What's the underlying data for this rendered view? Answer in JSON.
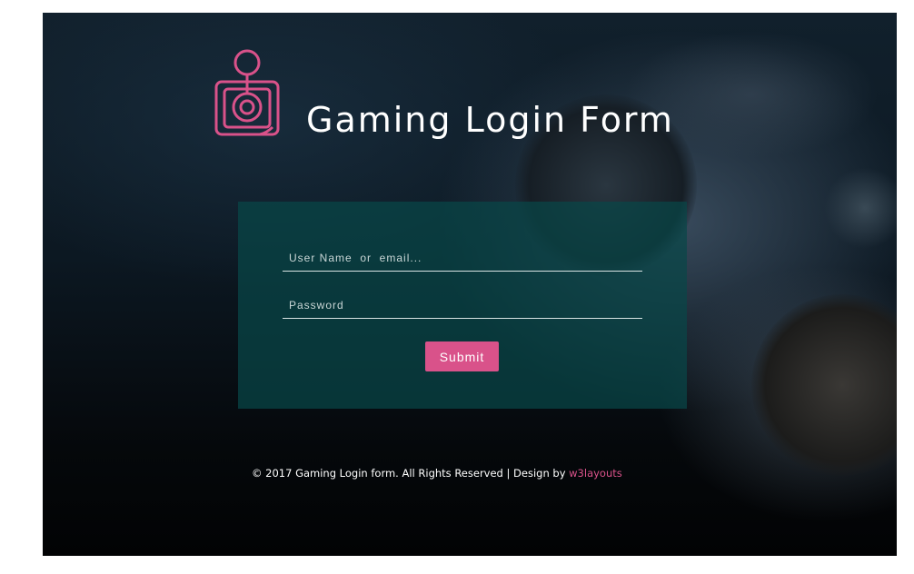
{
  "header": {
    "title": "Gaming Login Form",
    "logo_icon": "joystick-icon"
  },
  "form": {
    "username_placeholder": "User Name  or  email...",
    "password_placeholder": "Password",
    "submit_label": "Submit"
  },
  "footer": {
    "copyright_text": "© 2017 Gaming Login form. All Rights Reserved | Design by ",
    "designer_link": "w3layouts"
  },
  "colors": {
    "accent": "#d9528a",
    "card": "#084648",
    "background": "#0c1822"
  }
}
